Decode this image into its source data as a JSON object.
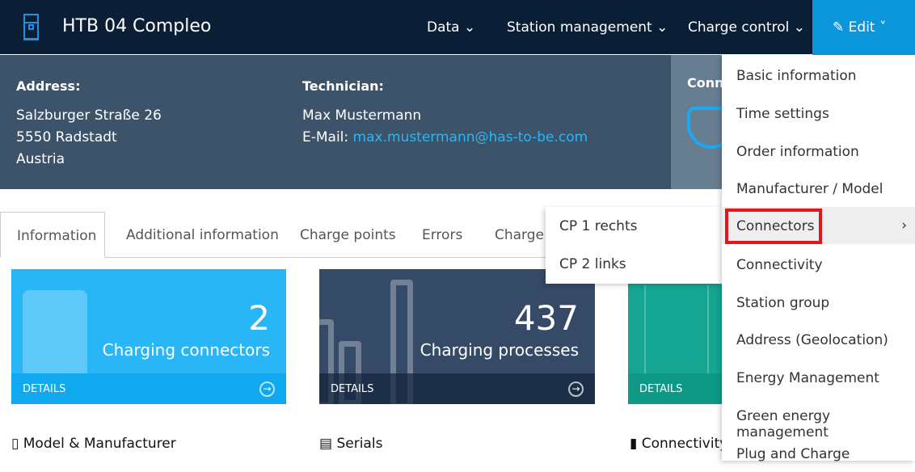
{
  "header": {
    "title": "HTB 04 Compleo",
    "nav": [
      "Data ⌄",
      "Station management ⌄",
      "Charge control ⌄"
    ],
    "edit": "Edit"
  },
  "info": {
    "address_label": "Address:",
    "address": [
      "Salzburger Straße 26",
      "5550 Radstadt",
      "Austria"
    ],
    "technician_label": "Technician:",
    "technician": "Max Mustermann",
    "email_label": "E-Mail:",
    "email": "max.mustermann@has-to-be.com",
    "connector_label": "Conne"
  },
  "tabs": [
    "Information",
    "Additional information",
    "Charge points",
    "Errors",
    "Charge l"
  ],
  "cards": [
    {
      "value": "2",
      "caption": "Charging connectors",
      "details": "DETAILS"
    },
    {
      "value": "437",
      "caption": "Charging processes",
      "details": "DETAILS"
    },
    {
      "details": "DETAILS"
    }
  ],
  "sections": [
    "Model & Manufacturer",
    "Serials",
    "Connectivity"
  ],
  "edit_menu": [
    "Basic information",
    "Time settings",
    "Order information",
    "Manufacturer / Model",
    "Connectors",
    "Connectivity",
    "Station group",
    "Address (Geolocation)",
    "Energy Management",
    "Green energy management",
    "Plug and Charge"
  ],
  "submenu": [
    "CP 1 rechts",
    "CP 2 links"
  ]
}
